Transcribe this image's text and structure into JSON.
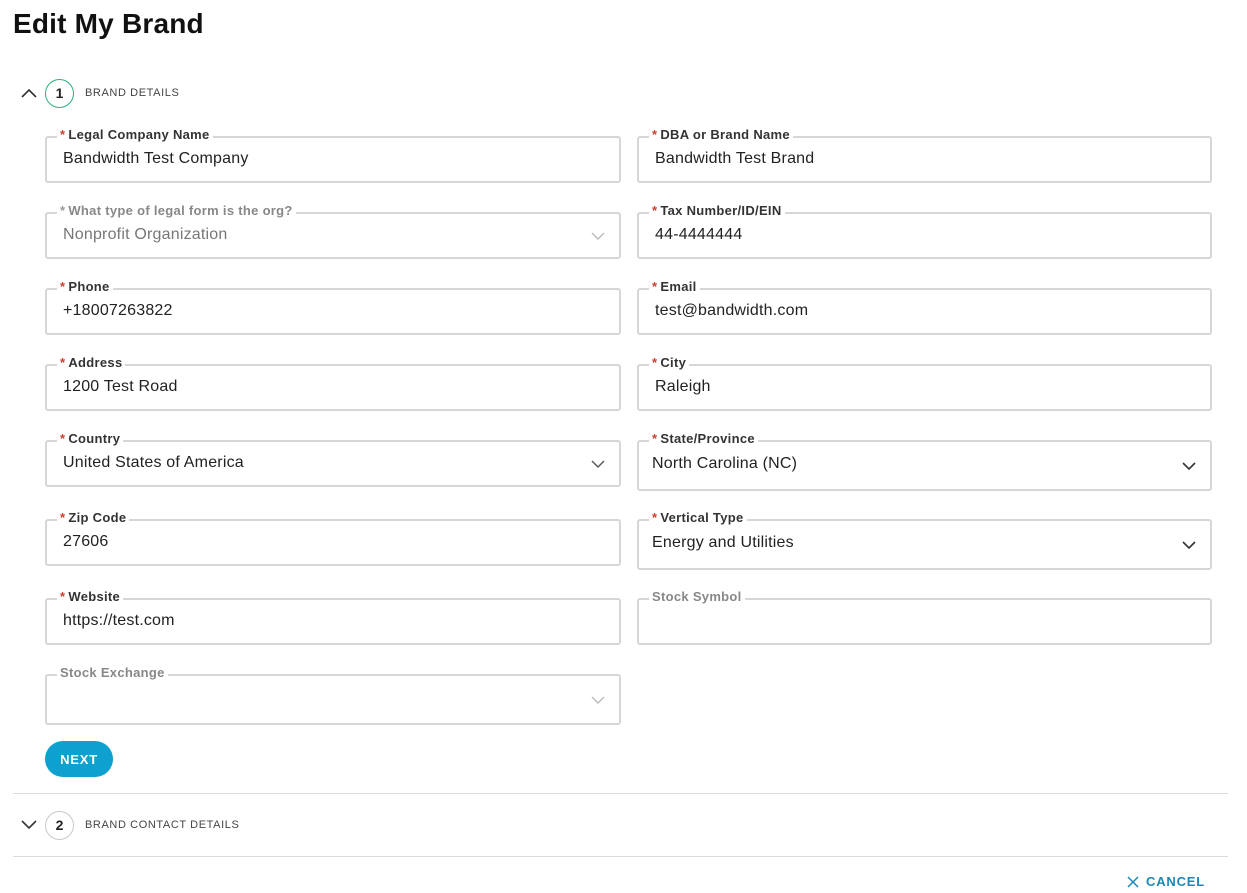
{
  "page": {
    "title": "Edit My Brand"
  },
  "steps": [
    {
      "number": "1",
      "label": "BRAND DETAILS",
      "expanded": true,
      "accent": "#2bb37a"
    },
    {
      "number": "2",
      "label": "BRAND CONTACT DETAILS",
      "expanded": false
    }
  ],
  "form": {
    "legal_company_name": {
      "label": "Legal Company Name",
      "required": true,
      "value": "Bandwidth Test Company"
    },
    "dba_brand_name": {
      "label": "DBA or Brand Name",
      "required": true,
      "value": "Bandwidth Test Brand"
    },
    "legal_form": {
      "label": "What type of legal form is the org?",
      "required": true,
      "value": "Nonprofit Organization",
      "disabled": true
    },
    "tax_number": {
      "label": "Tax Number/ID/EIN",
      "required": true,
      "value": "44-4444444"
    },
    "phone": {
      "label": "Phone",
      "required": true,
      "value": "+18007263822"
    },
    "email": {
      "label": "Email",
      "required": true,
      "value": "test@bandwidth.com"
    },
    "address": {
      "label": "Address",
      "required": true,
      "value": "1200 Test Road"
    },
    "city": {
      "label": "City",
      "required": true,
      "value": "Raleigh"
    },
    "country": {
      "label": "Country",
      "required": true,
      "value": "United States of America"
    },
    "state_province": {
      "label": "State/Province",
      "required": true,
      "value": "North Carolina (NC)"
    },
    "zip_code": {
      "label": "Zip Code",
      "required": true,
      "value": "27606"
    },
    "vertical_type": {
      "label": "Vertical Type",
      "required": true,
      "value": "Energy and Utilities"
    },
    "website": {
      "label": "Website",
      "required": true,
      "value": "https://test.com"
    },
    "stock_symbol": {
      "label": "Stock Symbol",
      "required": false,
      "value": ""
    },
    "stock_exchange": {
      "label": "Stock Exchange",
      "required": false,
      "value": ""
    }
  },
  "buttons": {
    "next": "NEXT",
    "cancel": "CANCEL"
  },
  "icons": {
    "expand": "chevron-up-icon",
    "collapse": "chevron-down-icon",
    "dropdown": "chevron-down-icon",
    "cancel": "close-icon"
  },
  "colors": {
    "primary": "#0ea0cf",
    "required": "#d23c2c",
    "link": "#1a88b8"
  }
}
